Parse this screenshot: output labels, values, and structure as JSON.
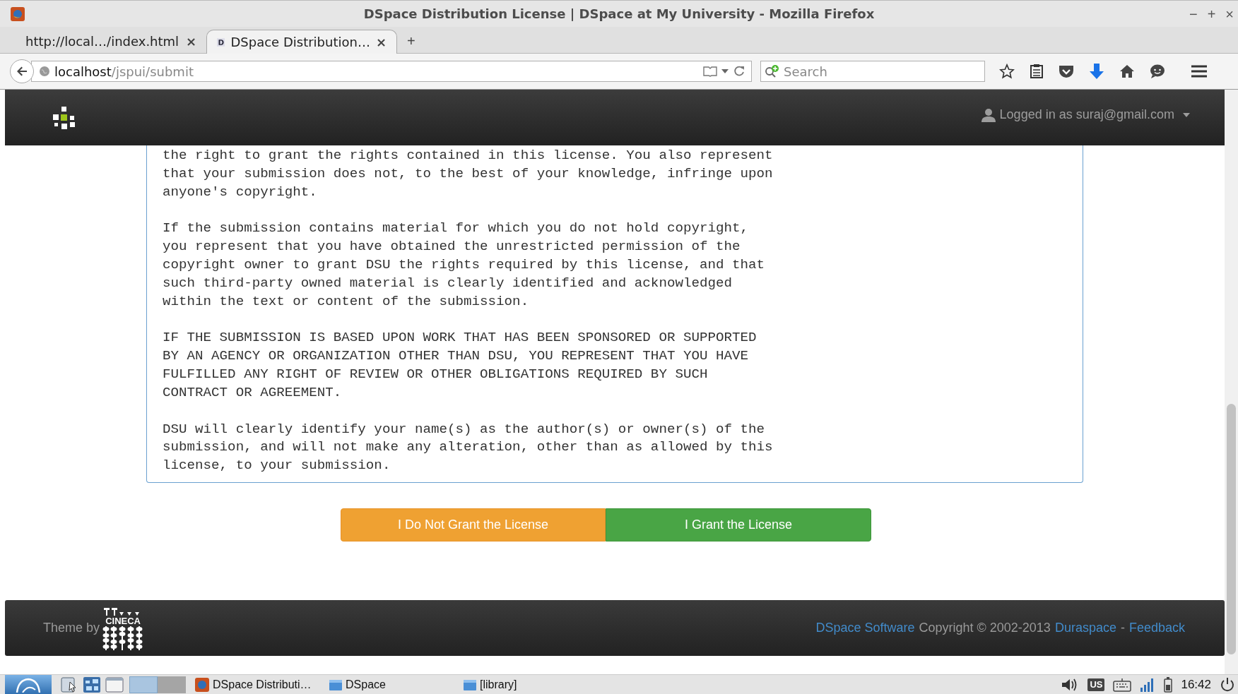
{
  "window": {
    "title": "DSpace Distribution License | DSpace at My University - Mozilla Firefox",
    "controls": [
      "−",
      "+",
      "×"
    ]
  },
  "tabs": [
    {
      "label": "http://local…/index.html",
      "close": "×",
      "selected": false,
      "kind": "plain"
    },
    {
      "label": "DSpace Distribution…",
      "close": "×",
      "selected": true,
      "kind": "dspace"
    }
  ],
  "new_tab": "+",
  "address_bar": {
    "host": "localhost",
    "path": "/jspui/submit"
  },
  "search": {
    "placeholder": "Search"
  },
  "header": {
    "user": "Logged in as suraj@gmail.com"
  },
  "license_paragraphs": [
    "the right to grant the rights contained in this license. You also represent\nthat your submission does not, to the best of your knowledge, infringe upon\nanyone's copyright.",
    "If the submission contains material for which you do not hold copyright,\nyou represent that you have obtained the unrestricted permission of the\ncopyright owner to grant DSU the rights required by this license, and that\nsuch third-party owned material is clearly identified and acknowledged\nwithin the text or content of the submission.",
    "IF THE SUBMISSION IS BASED UPON WORK THAT HAS BEEN SPONSORED OR SUPPORTED\nBY AN AGENCY OR ORGANIZATION OTHER THAN DSU, YOU REPRESENT THAT YOU HAVE\nFULFILLED ANY RIGHT OF REVIEW OR OTHER OBLIGATIONS REQUIRED BY SUCH\nCONTRACT OR AGREEMENT.",
    "DSU will clearly identify your name(s) as the author(s) or owner(s) of the\nsubmission, and will not make any alteration, other than as allowed by this\nlicense, to your submission."
  ],
  "buttons": [
    {
      "label": "I Do Not Grant the License",
      "kind": "decline"
    },
    {
      "label": "I Grant the License",
      "kind": "grant"
    }
  ],
  "footer": {
    "theme_by": "Theme by",
    "logo_text": "CINECA",
    "items": [
      {
        "text": "DSpace Software",
        "kind": "link"
      },
      {
        "text": "Copyright © 2002-2013",
        "kind": "text"
      },
      {
        "text": "Duraspace",
        "kind": "link"
      },
      {
        "text": "-",
        "kind": "text"
      },
      {
        "text": "Feedback",
        "kind": "link"
      }
    ]
  },
  "taskbar": {
    "windows": [
      {
        "label": "DSpace Distributi…",
        "kind": "browser"
      },
      {
        "label": "DSpace",
        "kind": "folder"
      },
      {
        "label": "[library]",
        "kind": "folder"
      }
    ],
    "keyboard": "US",
    "clock": "16:42"
  }
}
